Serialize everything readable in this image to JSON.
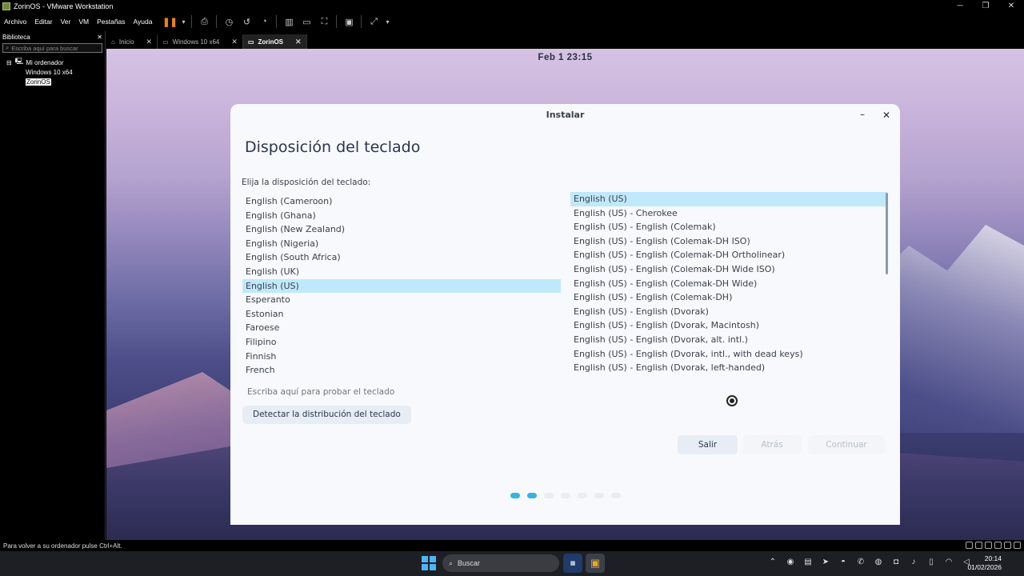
{
  "window": {
    "title": "ZorinOS - VMware Workstation",
    "controls": [
      "─",
      "❐",
      "✕"
    ]
  },
  "menu": [
    "Archivo",
    "Editar",
    "Ver",
    "VM",
    "Pestañas",
    "Ayuda"
  ],
  "library": {
    "title": "Biblioteca",
    "search_placeholder": "Escriba aquí para buscar",
    "root": "Mi ordenador",
    "items": [
      "Windows 10 x64",
      "ZorinOS"
    ]
  },
  "tabs": [
    {
      "label": "Inicio",
      "active": false
    },
    {
      "label": "Windows 10 x64",
      "active": false
    },
    {
      "label": "ZorinOS",
      "active": true
    }
  ],
  "vm": {
    "clock": "Feb 1  23:15",
    "installer": {
      "title": "Instalar",
      "heading": "Disposición del teclado",
      "prompt": "Elija la disposición del teclado:",
      "languages": [
        "English (Cameroon)",
        "English (Ghana)",
        "English (New Zealand)",
        "English (Nigeria)",
        "English (South Africa)",
        "English (UK)",
        "English (US)",
        "Esperanto",
        "Estonian",
        "Faroese",
        "Filipino",
        "Finnish",
        "French"
      ],
      "selected_language": "English (US)",
      "variants": [
        "English (US)",
        "English (US) - Cherokee",
        "English (US) - English (Colemak)",
        "English (US) - English (Colemak-DH ISO)",
        "English (US) - English (Colemak-DH Ortholinear)",
        "English (US) - English (Colemak-DH Wide ISO)",
        "English (US) - English (Colemak-DH Wide)",
        "English (US) - English (Colemak-DH)",
        "English (US) - English (Dvorak)",
        "English (US) - English (Dvorak, Macintosh)",
        "English (US) - English (Dvorak, alt. intl.)",
        "English (US) - English (Dvorak, intl., with dead keys)",
        "English (US) - English (Dvorak, left-handed)"
      ],
      "selected_variant": "English (US)",
      "test_placeholder": "Escriba aquí para probar el teclado",
      "detect_button": "Detectar la distribución del teclado",
      "quit_button": "Salir",
      "back_button": "Atrás",
      "continue_button": "Continuar",
      "steps_total": 7,
      "steps_active": 2
    }
  },
  "status": {
    "text": "Para volver a su ordenador pulse Ctrl+Alt."
  },
  "taskbar": {
    "search_label": "Buscar",
    "time": "20:14",
    "date": "01/02/2026"
  },
  "colors": {
    "selection": "#bfe9fb",
    "accent": "#38b2e6",
    "vmware_pause": "#f08020"
  }
}
